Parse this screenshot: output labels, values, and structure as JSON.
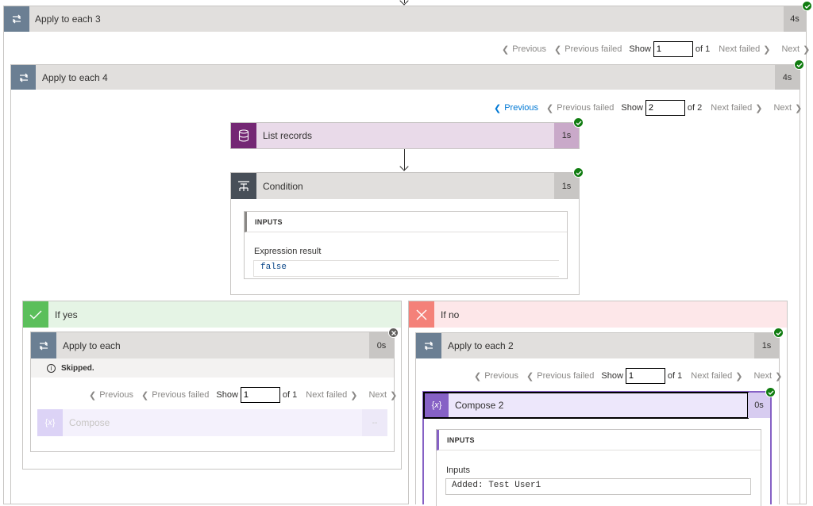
{
  "apply3": {
    "title": "Apply to each 3",
    "duration": "4s"
  },
  "pager1": {
    "previous": "Previous",
    "previous_failed": "Previous failed",
    "show": "Show",
    "value": "1",
    "of": "of 1",
    "next_failed": "Next failed",
    "next": "Next"
  },
  "apply4": {
    "title": "Apply to each 4",
    "duration": "4s"
  },
  "pager2": {
    "previous": "Previous",
    "previous_failed": "Previous failed",
    "show": "Show",
    "value": "2",
    "of": "of 2",
    "next_failed": "Next failed",
    "next": "Next"
  },
  "list_records": {
    "title": "List records",
    "duration": "1s",
    "accent": "#742774"
  },
  "condition": {
    "title": "Condition",
    "duration": "1s",
    "inputs_label": "INPUTS",
    "expression_label": "Expression result",
    "expression_value": "false"
  },
  "if_yes": {
    "title": "If yes",
    "color": "#5bbf5b"
  },
  "if_no": {
    "title": "If no",
    "color": "#f48179"
  },
  "apply_each": {
    "title": "Apply to each",
    "duration": "0s",
    "skipped": "Skipped."
  },
  "pager3": {
    "previous": "Previous",
    "previous_failed": "Previous failed",
    "show": "Show",
    "value": "1",
    "of": "of 1",
    "next_failed": "Next failed",
    "next": "Next"
  },
  "compose": {
    "title": "Compose",
    "duration": "--"
  },
  "apply_each2": {
    "title": "Apply to each 2",
    "duration": "1s"
  },
  "pager4": {
    "previous": "Previous",
    "previous_failed": "Previous failed",
    "show": "Show",
    "value": "1",
    "of": "of 1",
    "next_failed": "Next failed",
    "next": "Next"
  },
  "compose2": {
    "title": "Compose 2",
    "duration": "0s",
    "inputs_label": "INPUTS",
    "inputs_field_label": "Inputs",
    "inputs_value": "Added: Test User1"
  }
}
